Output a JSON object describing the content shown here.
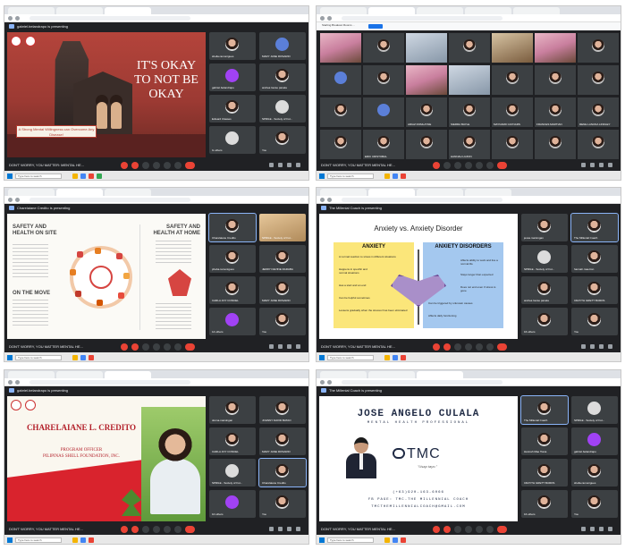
{
  "meet": {
    "title": "DON'T WORRY, YOU MATTER: MENTAL HE...",
    "title_short": "DON'T WORRY, YOU MATTER MENTAL HE...",
    "search_placeholder": "Type here to search"
  },
  "s1": {
    "presenting": "gabriel.belandrapo is presenting",
    "slide_title": "IT'S OKAY TO NOT BE OKAY",
    "slide_box": "A Strong Mental Willingness can Overcome Any Disease!",
    "tiles": [
      "shella.ramonigues",
      "MARY JANE ROSARIO",
      "gabriel.belandrapo",
      "andrea louise panela",
      "Edward Classes",
      "SPRILE - Society of Fut...",
      "G others",
      "You"
    ]
  },
  "s2": {
    "topbar": "Starting Breakout Rooms ...",
    "tiles": [
      "",
      "",
      "",
      "",
      "",
      "",
      "",
      "",
      "",
      "",
      "",
      "",
      "",
      "",
      "",
      "",
      "ARIAZ ROMLAYNE",
      "SIERRA BAYLE",
      "MAYNARD CAYNARS",
      "FRANCES MARTIAN",
      "RENE LANUNA LINDLEY",
      "",
      "ERIC CRISTOBAL",
      "",
      "HANNAH LUZON",
      "",
      "",
      "",
      "",
      "",
      "",
      "",
      "",
      "",
      ""
    ]
  },
  "s3": {
    "presenting": "Charelaiane Credito is presenting",
    "h_left": "SAFETY AND HEALTH ON SITE",
    "h_right": "SAFETY AND HEALTH AT HOME",
    "h_move": "ON THE MOVE",
    "tiles": [
      "Charelaiane Credito",
      "SPRILE - Society of Fut...",
      "pheba.ramonigues",
      "JERRY DEVINE RARABA",
      "CARLA JOY CONCEL",
      "MARY JANE ROSARIO",
      "14 others",
      "You"
    ]
  },
  "s4": {
    "presenting": "The Millenial Coach is presenting",
    "slide_title": "Anxiety vs. Anxiety Disorder",
    "left_h": "ANXIETY",
    "right_h": "ANXIETY DISORDERS",
    "left_lines": [
      "A normal reaction to stress in different situations",
      "Happens in specific and normal situations",
      "Has a start and an end",
      "Can be helpful sometimes",
      "Lessens gradually when the stressor has been eliminated"
    ],
    "right_lines": [
      "Affects ability to work and live a normal life",
      "Stays longer than expected",
      "Does not end even if stress is gone",
      "Can be triggered by unknown causes",
      "Affects daily functioning"
    ],
    "tiles": [
      "jessa.marsingan",
      "The Millenial Coach",
      "SPRILE - Society of Fut...",
      "hannah.mae.bsn",
      "andrea louise panela",
      "CRAYTH GRETT BURDS",
      "16 others",
      "You"
    ]
  },
  "s5": {
    "presenting": "gabriel.belandrapo is presenting",
    "name": "CHARELAIANE L. CREDITO",
    "role1": "PROGRAM OFFICER",
    "role2": "PILIPINAS SHELL FOUNDATION, INC.",
    "tiles": [
      "donna.marsingan",
      "JOHNNY DAVID BATAO",
      "CARLA JOY CONCEL",
      "MARY JANE ROSARIO",
      "SPRILE - Society of Fut...",
      "Charelaiane Credito",
      "10 others",
      "You"
    ]
  },
  "s6": {
    "presenting": "The Millenial Coach is presenting",
    "name": "JOSE ANGELO CULALA",
    "role": "MENTAL HEALTH PROFESSIONAL",
    "brand": "TMC",
    "tagline": "\"Usap tayo.\"",
    "phone": "(+63)920-163-6066",
    "fb": "FB PAGE: TMC-THE MILLENNIAL COACH",
    "email": "TMCTHEMILLENNIALCOACH@GMAIL.COM",
    "tiles": [
      "The Millenial Coach",
      "SPRILE - Society of Fut...",
      "Hannah Mae Tiana",
      "gabriel.belandrapo",
      "CRAYTH GRETT BURDS",
      "shella.ramonigues",
      "16 others",
      "You"
    ]
  }
}
